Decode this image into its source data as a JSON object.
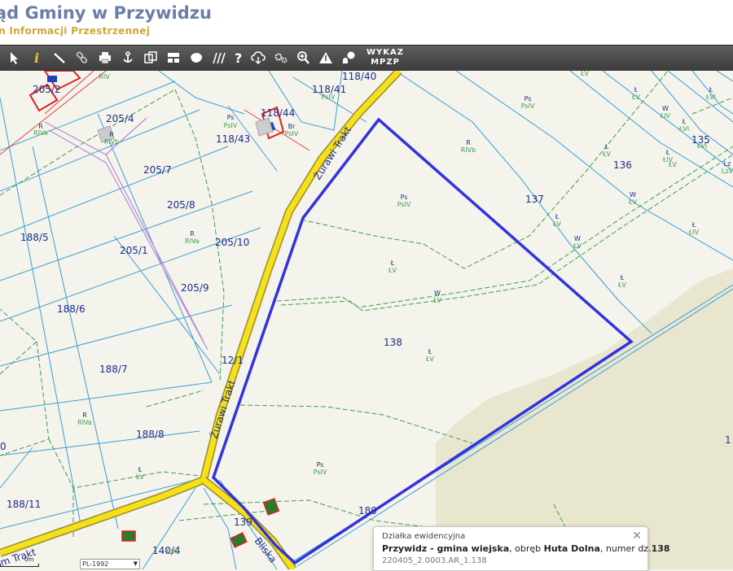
{
  "header": {
    "title": "ąd Gminy w Przywidzu",
    "subtitle": "n Informacji Przestrzennej"
  },
  "toolbar": {
    "tools": [
      "select-arrow-icon",
      "info-icon",
      "measure-icon",
      "link-icon",
      "print-icon",
      "anchor-icon",
      "copy-icon",
      "layout-icon",
      "shape-icon",
      "hatch-icon",
      "help-icon",
      "cloud-download-icon",
      "settings-icon",
      "zoom-icon",
      "warning-icon",
      "chat-icon"
    ],
    "wykaz_line1": "WYKAZ",
    "wykaz_line2": "MPZP"
  },
  "map": {
    "parcel_labels": [
      "205/2",
      "118/40",
      "118/41",
      "118/44",
      "118/43",
      "205/4",
      "205/7",
      "205/8",
      "205/1",
      "205/10",
      "205/9",
      "188/5",
      "188/6",
      "188/7",
      "188/8",
      "188/11",
      "12/1",
      "137",
      "136",
      "135",
      "138",
      "139",
      "140/4",
      "180",
      "1",
      "0"
    ],
    "land_labels": [
      "R",
      "RIVa",
      "RIVb",
      "Ps",
      "PsIV",
      "Ł",
      "ŁV",
      "ŁIV",
      "ŁVI",
      "W",
      "Br",
      "Lz",
      "LzV",
      "RVI",
      "ŁIV"
    ],
    "roads": [
      "Żurawi Trakt",
      "Bliska",
      "Żurawi Trakt",
      "m Trakt"
    ],
    "highlight_parcel": "138",
    "highlight_color": "#3333dd",
    "road_color": "#f5e01a"
  },
  "popup": {
    "header": "Działka ewidencyjna",
    "name": "Przywidz - gmina wiejska",
    "obreb_label": ", obręb ",
    "obreb": "Huta Dolna",
    "numer_label": ", numer dz.",
    "numer": "138",
    "id": "220405_2.0003.AR_1.138",
    "close": "✕"
  },
  "crs": {
    "selected": "PL-1992"
  },
  "scale": {
    "label": "0m"
  }
}
